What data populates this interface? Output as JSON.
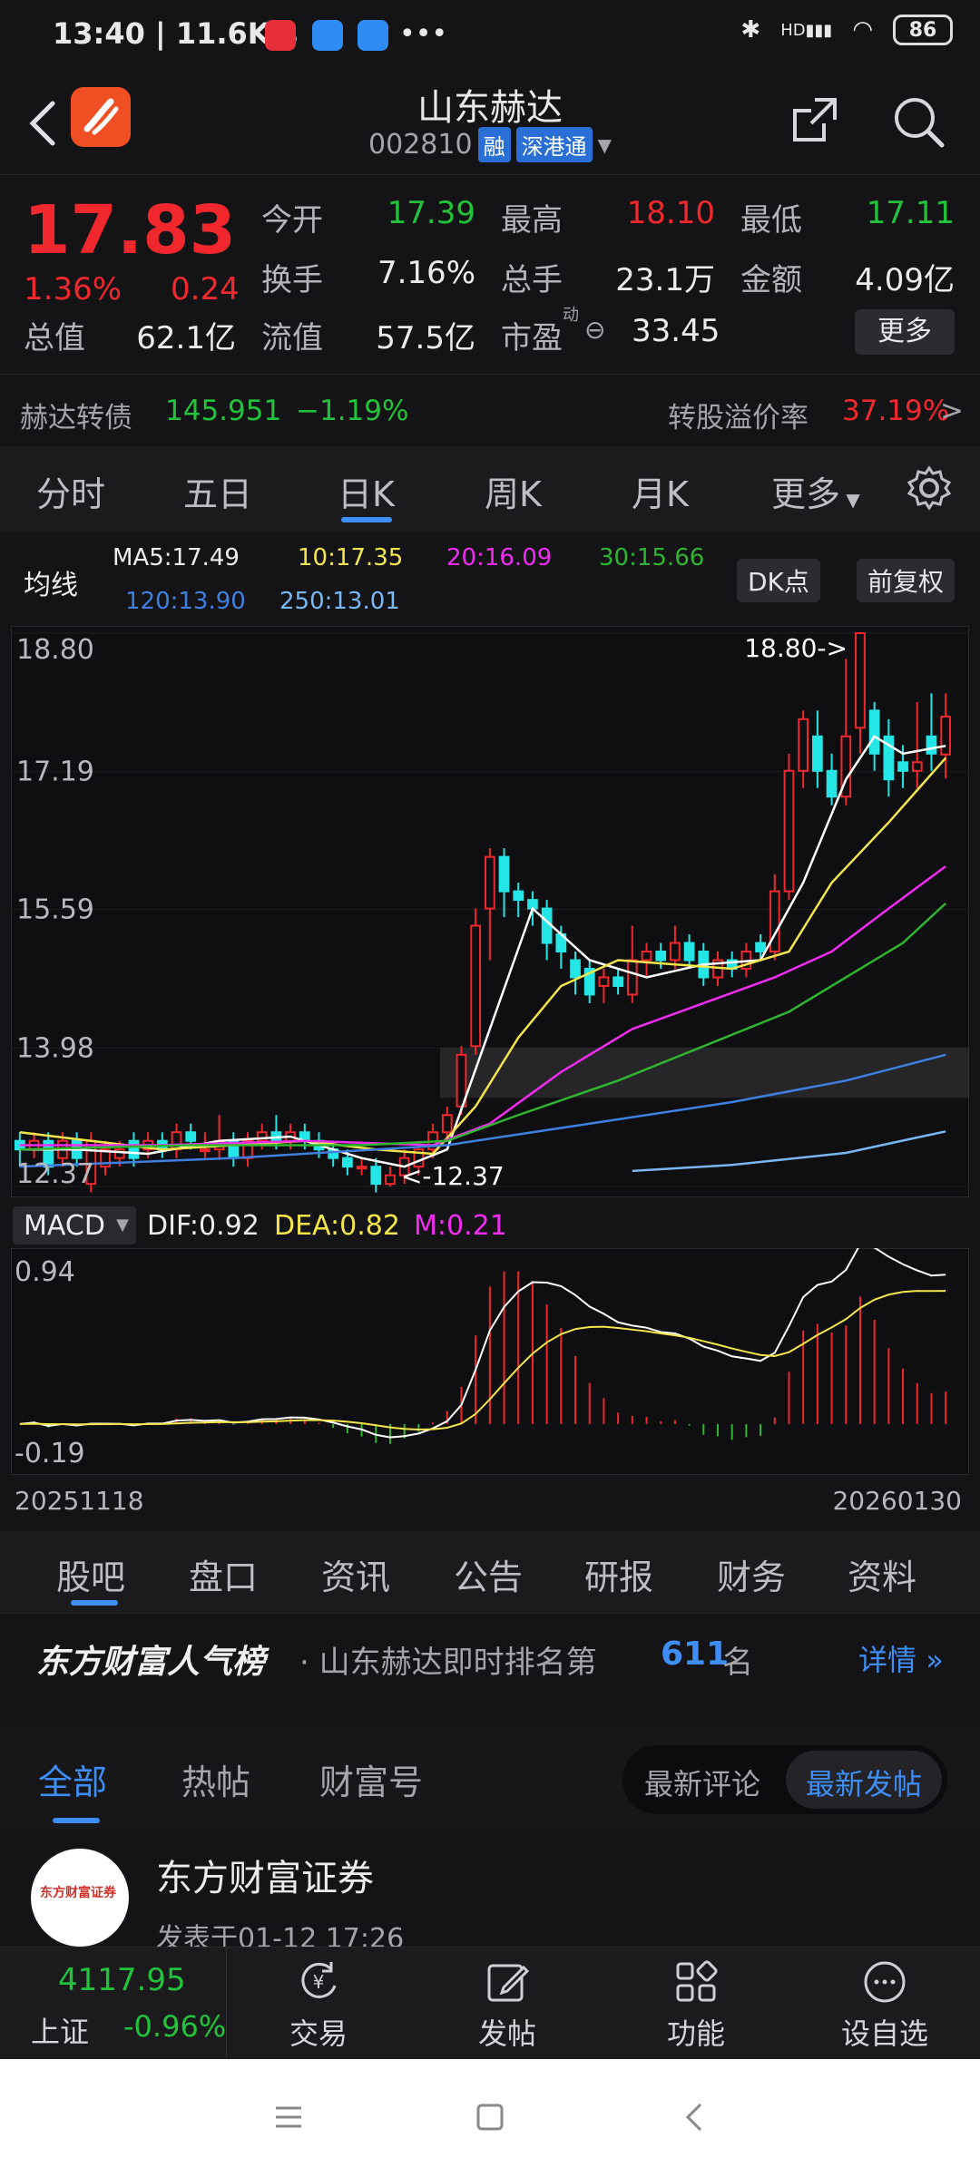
{
  "status": {
    "time_speed": "13:40 | 11.6K/s",
    "battery": "86",
    "signal_label": "HD"
  },
  "header": {
    "name": "山东赫达",
    "code": "002810",
    "tag_rong": "融",
    "tag_sgt": "深港通"
  },
  "quote": {
    "price": "17.83",
    "pct": "1.36%",
    "change": "0.24",
    "rows": [
      [
        {
          "label": "今开",
          "value": "17.39",
          "color": "green"
        },
        {
          "label": "最高",
          "value": "18.10",
          "color": "red"
        },
        {
          "label": "最低",
          "value": "17.11",
          "color": "green"
        }
      ],
      [
        {
          "label": "换手",
          "value": "7.16%",
          "color": "white"
        },
        {
          "label": "总手",
          "value": "23.1万",
          "color": "white"
        },
        {
          "label": "金额",
          "value": "4.09亿",
          "color": "white"
        }
      ]
    ],
    "total_label": "总值",
    "total_value": "62.1亿",
    "float_label": "流值",
    "float_value": "57.5亿",
    "pe_label": "市盈",
    "pe_superscript": "动",
    "pe_value": "33.45",
    "more": "更多"
  },
  "cbond": {
    "name": "赫达转债",
    "price": "145.951",
    "pct": "−1.19%",
    "premium_label": "转股溢价率",
    "premium_value": "37.19%",
    "arrow": ">"
  },
  "ktabs": {
    "items": [
      "分时",
      "五日",
      "日K",
      "周K",
      "月K",
      "更多"
    ],
    "active": "日K"
  },
  "ma_legend": {
    "title": "均线",
    "ma5": "MA5:17.49",
    "ma10": "10:17.35",
    "ma20": "20:16.09",
    "ma30": "30:15.66",
    "ma120": "120:13.90",
    "ma250": "250:13.01",
    "dk": "DK点",
    "fq": "前复权"
  },
  "colors": {
    "up": "#f0282e",
    "down": "#25e6e6",
    "ma5": "#ffffff",
    "ma10": "#f2e64a",
    "ma20": "#f02cf0",
    "ma30": "#2fb52f",
    "ma120": "#3f7fe0",
    "ma250": "#7ab8f5"
  },
  "chart_data": {
    "type": "candlestick",
    "y_ticks": [
      "18.80",
      "17.19",
      "15.59",
      "13.98",
      "12.37"
    ],
    "ylim": [
      12.37,
      18.8
    ],
    "high_marker": "18.80->",
    "low_marker": "<-12.37",
    "candles": [
      [
        12.9,
        12.8,
        13.0,
        12.6
      ],
      [
        12.8,
        12.9,
        13.0,
        12.7
      ],
      [
        12.9,
        12.6,
        13.0,
        12.5
      ],
      [
        12.7,
        12.9,
        13.0,
        12.6
      ],
      [
        12.9,
        12.7,
        13.0,
        12.6
      ],
      [
        12.4,
        12.9,
        13.0,
        12.3
      ],
      [
        12.6,
        12.8,
        12.9,
        12.5
      ],
      [
        12.7,
        12.8,
        12.9,
        12.6
      ],
      [
        12.9,
        12.7,
        13.0,
        12.6
      ],
      [
        12.8,
        12.9,
        13.0,
        12.7
      ],
      [
        12.9,
        12.8,
        13.0,
        12.7
      ],
      [
        12.8,
        13.0,
        13.1,
        12.7
      ],
      [
        13.0,
        12.9,
        13.1,
        12.8
      ],
      [
        12.8,
        12.8,
        13.0,
        12.7
      ],
      [
        12.8,
        12.9,
        13.2,
        12.7
      ],
      [
        12.9,
        12.7,
        13.0,
        12.6
      ],
      [
        12.7,
        12.9,
        13.0,
        12.6
      ],
      [
        12.9,
        13.0,
        13.1,
        12.8
      ],
      [
        13.0,
        12.9,
        13.2,
        12.8
      ],
      [
        12.9,
        13.0,
        13.1,
        12.8
      ],
      [
        13.0,
        12.9,
        13.1,
        12.8
      ],
      [
        12.9,
        12.8,
        13.0,
        12.7
      ],
      [
        12.8,
        12.7,
        12.9,
        12.6
      ],
      [
        12.7,
        12.6,
        12.8,
        12.5
      ],
      [
        12.6,
        12.6,
        12.7,
        12.5
      ],
      [
        12.6,
        12.4,
        12.7,
        12.3
      ],
      [
        12.4,
        12.5,
        12.6,
        12.37
      ],
      [
        12.5,
        12.7,
        12.8,
        12.4
      ],
      [
        12.6,
        12.8,
        12.9,
        12.5
      ],
      [
        12.8,
        13.0,
        13.1,
        12.7
      ],
      [
        13.0,
        13.2,
        13.3,
        12.9
      ],
      [
        13.3,
        13.9,
        14.0,
        13.2
      ],
      [
        14.0,
        15.4,
        15.6,
        13.9
      ],
      [
        15.6,
        16.2,
        16.3,
        15.0
      ],
      [
        16.2,
        15.8,
        16.3,
        15.5
      ],
      [
        15.8,
        15.7,
        15.9,
        15.5
      ],
      [
        15.7,
        15.6,
        15.8,
        15.4
      ],
      [
        15.6,
        15.2,
        15.7,
        15.0
      ],
      [
        15.3,
        15.1,
        15.4,
        14.9
      ],
      [
        15.0,
        14.8,
        15.1,
        14.6
      ],
      [
        14.9,
        14.6,
        15.0,
        14.5
      ],
      [
        14.7,
        14.8,
        14.9,
        14.5
      ],
      [
        14.8,
        14.7,
        14.9,
        14.6
      ],
      [
        14.6,
        15.0,
        15.4,
        14.5
      ],
      [
        15.0,
        15.1,
        15.2,
        14.8
      ],
      [
        15.1,
        15.0,
        15.2,
        14.9
      ],
      [
        15.0,
        15.2,
        15.4,
        14.9
      ],
      [
        15.2,
        15.0,
        15.3,
        14.9
      ],
      [
        15.1,
        14.8,
        15.2,
        14.7
      ],
      [
        14.8,
        15.0,
        15.1,
        14.7
      ],
      [
        15.0,
        14.9,
        15.1,
        14.8
      ],
      [
        14.9,
        15.1,
        15.2,
        14.8
      ],
      [
        15.2,
        15.1,
        15.3,
        15.0
      ],
      [
        15.1,
        15.8,
        16.0,
        15.0
      ],
      [
        15.8,
        17.2,
        17.4,
        15.7
      ],
      [
        17.2,
        17.8,
        17.9,
        17.0
      ],
      [
        17.6,
        17.2,
        17.9,
        17.0
      ],
      [
        17.2,
        16.9,
        17.4,
        16.8
      ],
      [
        16.9,
        17.6,
        18.5,
        16.8
      ],
      [
        17.7,
        18.8,
        18.8,
        17.4
      ],
      [
        17.9,
        17.4,
        18.0,
        17.2
      ],
      [
        17.6,
        17.1,
        17.8,
        16.9
      ],
      [
        17.3,
        17.2,
        17.5,
        17.0
      ],
      [
        17.2,
        17.3,
        18.0,
        17.0
      ],
      [
        17.6,
        17.4,
        18.1,
        17.2
      ],
      [
        17.39,
        17.83,
        18.1,
        17.11
      ]
    ],
    "ma_lines": {
      "ma5": [
        [
          0,
          12.8
        ],
        [
          4,
          12.8
        ],
        [
          9,
          12.75
        ],
        [
          14,
          12.9
        ],
        [
          19,
          12.95
        ],
        [
          24,
          12.7
        ],
        [
          27,
          12.6
        ],
        [
          30,
          12.8
        ],
        [
          33,
          14.2
        ],
        [
          36,
          15.6
        ],
        [
          40,
          15.0
        ],
        [
          44,
          14.8
        ],
        [
          48,
          14.95
        ],
        [
          52,
          15.0
        ],
        [
          55,
          15.9
        ],
        [
          58,
          17.1
        ],
        [
          60,
          17.6
        ],
        [
          62,
          17.4
        ],
        [
          65,
          17.49
        ]
      ],
      "ma10": [
        [
          0,
          13.0
        ],
        [
          5,
          12.9
        ],
        [
          10,
          12.8
        ],
        [
          15,
          12.85
        ],
        [
          20,
          12.9
        ],
        [
          25,
          12.8
        ],
        [
          29,
          12.75
        ],
        [
          32,
          13.3
        ],
        [
          35,
          14.1
        ],
        [
          38,
          14.7
        ],
        [
          42,
          15.0
        ],
        [
          46,
          14.95
        ],
        [
          50,
          14.9
        ],
        [
          54,
          15.1
        ],
        [
          57,
          15.9
        ],
        [
          61,
          16.6
        ],
        [
          65,
          17.35
        ]
      ],
      "ma20": [
        [
          0,
          12.85
        ],
        [
          10,
          12.85
        ],
        [
          20,
          12.9
        ],
        [
          29,
          12.85
        ],
        [
          33,
          13.1
        ],
        [
          38,
          13.7
        ],
        [
          43,
          14.2
        ],
        [
          48,
          14.5
        ],
        [
          53,
          14.8
        ],
        [
          57,
          15.1
        ],
        [
          61,
          15.6
        ],
        [
          65,
          16.09
        ]
      ],
      "ma30": [
        [
          0,
          12.8
        ],
        [
          12,
          12.85
        ],
        [
          24,
          12.85
        ],
        [
          30,
          12.9
        ],
        [
          35,
          13.2
        ],
        [
          42,
          13.6
        ],
        [
          48,
          14.0
        ],
        [
          54,
          14.4
        ],
        [
          58,
          14.8
        ],
        [
          62,
          15.2
        ],
        [
          65,
          15.66
        ]
      ],
      "ma120": [
        [
          0,
          12.6
        ],
        [
          15,
          12.7
        ],
        [
          30,
          12.85
        ],
        [
          40,
          13.1
        ],
        [
          50,
          13.35
        ],
        [
          58,
          13.6
        ],
        [
          65,
          13.9
        ]
      ],
      "ma250": [
        [
          43,
          12.55
        ],
        [
          50,
          12.62
        ],
        [
          58,
          12.76
        ],
        [
          65,
          13.01
        ]
      ]
    },
    "macd": {
      "dif": 0.92,
      "dea": 0.82,
      "m": 0.21,
      "y_ticks": [
        "0.94",
        "-0.19"
      ],
      "ylim": [
        -0.28,
        1.05
      ]
    },
    "date_start": "20251118",
    "date_end": "20260130"
  },
  "macd_head": {
    "label": "MACD",
    "dif": "DIF:0.92",
    "dea": "DEA:0.82",
    "m": "M:0.21"
  },
  "guba_tabs": {
    "items": [
      "股吧",
      "盘口",
      "资讯",
      "公告",
      "研报",
      "财务",
      "资料"
    ],
    "active": "股吧"
  },
  "rank": {
    "title": "东方财富人气榜",
    "text": "· 山东赫达即时排名第",
    "number": "611",
    "unit": "名",
    "detail": "详情"
  },
  "post_tabs": {
    "items": [
      "全部",
      "热帖",
      "财富号"
    ],
    "active": "全部",
    "sort_a": "最新评论",
    "sort_b": "最新发帖"
  },
  "post": {
    "author": "东方财富证券",
    "meta": "发表于01-12 17:26"
  },
  "bottomnav": {
    "index_value": "4117.95",
    "index_name": "上证",
    "index_pct": "-0.96%",
    "items": [
      "交易",
      "发帖",
      "功能",
      "设自选"
    ]
  }
}
